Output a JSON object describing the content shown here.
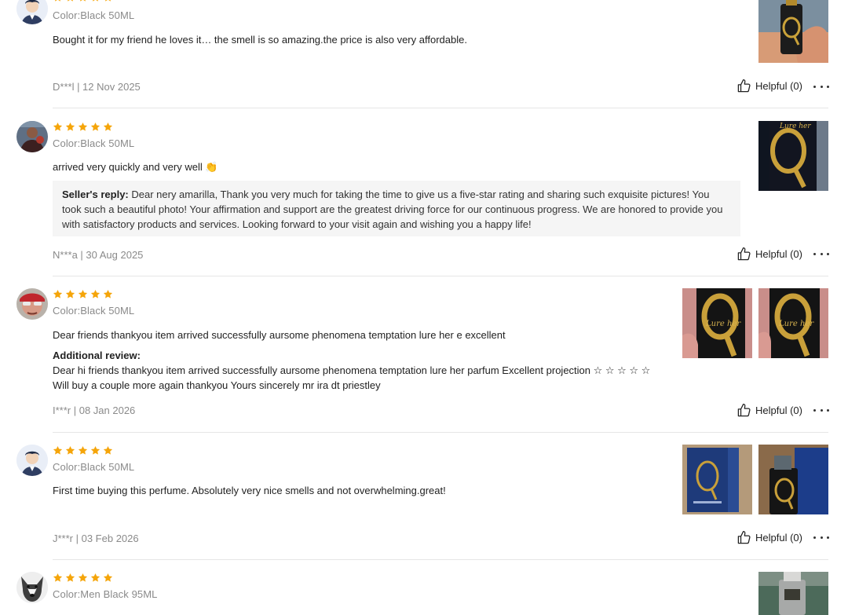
{
  "reviews": [
    {
      "stars": 5,
      "color": "Color:Black 50ML",
      "text": "Bought it for my friend he loves it… the smell is so amazing.the price is also very affordable.",
      "meta": "D***l | 12 Nov 2025",
      "helpful": "Helpful (0)",
      "avatar_icon": "cartoon-man-avatar",
      "photos": [
        "hand-holding-gold-perfume-bottle"
      ]
    },
    {
      "stars": 5,
      "color": "Color:Black 50ML",
      "text": "arrived very quickly and very well 👏",
      "seller_reply_label": "Seller's reply:",
      "seller_reply": " Dear nery amarilla, Thank you very much for taking the time to give us a five-star rating and sharing such exquisite pictures! You took such a beautiful photo! Your affirmation and support are the greatest driving force for our continuous progress. We are honored to provide you with satisfactory products and services. Looking forward to your visit again and wishing you a happy life!",
      "meta": "N***a | 30 Aug 2025",
      "helpful": "Helpful (0)",
      "avatar_icon": "user-photo-avatar",
      "photos": [
        "lure-her-perfume-closeup"
      ],
      "photo_text": "Lure her"
    },
    {
      "stars": 5,
      "color": "Color:Black 50ML",
      "text": "Dear friends thankyou item arrived successfully aursome phenomena temptation lure her e excellent",
      "additional_label": "Additional review:",
      "additional_text": "Dear hi friends thankyou item arrived successfully aursome phenomena temptation lure her parfum Excellent projection ☆ ☆ ☆ ☆ ☆ Will buy a couple more again thankyou Yours sincerely mr ira dt priestley",
      "meta": "I***r | 08 Jan 2026",
      "helpful": "Helpful (0)",
      "avatar_icon": "user-with-glasses-avatar",
      "photos": [
        "lure-her-bottle-in-hand-1",
        "lure-her-bottle-in-hand-2"
      ],
      "photo_text": "Lure her"
    },
    {
      "stars": 5,
      "color": "Color:Black 50ML",
      "text": "First time buying this perfume. Absolutely very nice smells and not overwhelming.great!",
      "meta": "J***r | 03 Feb 2026",
      "helpful": "Helpful (0)",
      "avatar_icon": "cartoon-man-avatar",
      "photos": [
        "blue-perfume-box",
        "perfume-bottle-with-box"
      ]
    },
    {
      "stars": 5,
      "color": "Color:Men Black 95ML",
      "avatar_icon": "husky-dog-avatar",
      "photos": [
        "silver-perfume-bottle"
      ]
    }
  ],
  "colors": {
    "star": "#f5a50a",
    "meta_text": "#8a8a8a",
    "seller_box_bg": "#f5f5f5",
    "divider": "#e6e6e6"
  }
}
